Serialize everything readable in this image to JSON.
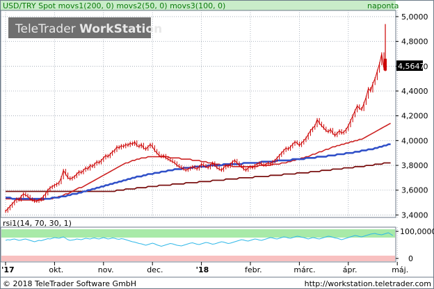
{
  "header": {
    "title": "USD/TRY Spot movs1(200, 0) movs2(50, 0) movs3(100, 0)",
    "period": "naponta"
  },
  "logo": {
    "text_regular": "TeleTrader ",
    "text_bold": "WorkStation"
  },
  "last_price": "4,5647",
  "rsi_header": "rsi1(14, 70, 30, 1)",
  "footer": {
    "copyright": "© 2018 TeleTrader Software GmbH",
    "url": "http://workstation.teletrader.com"
  },
  "colors": {
    "header_bg": "#c9ecc9",
    "header_text": "#0a7a0a",
    "price": "#cc0000",
    "ma200": "#7a1010",
    "ma50": "#cc2222",
    "ma100": "#3050c8",
    "rsi_line": "#30b8e8",
    "rsi_overbought": "#a8eaa8",
    "rsi_oversold": "#f8c0c0",
    "grid": "#9aa4b0"
  },
  "chart_data": [
    {
      "type": "line",
      "title": "USD/TRY Spot",
      "ylim": [
        3.38,
        5.05
      ],
      "y_ticks": [
        "3,4000",
        "3,6000",
        "3,8000",
        "4,0000",
        "4,2000",
        "4,4000",
        "4,6000",
        "4,8000",
        "5,0000"
      ],
      "x_ticks": [
        "'17",
        "okt.",
        "nov.",
        "dec.",
        "'18",
        "febr.",
        "márc.",
        "ápr.",
        "máj."
      ],
      "x_tick_index": [
        0,
        22,
        44,
        66,
        88,
        110,
        132,
        154,
        176
      ],
      "series": [
        {
          "name": "USD/TRY Spot",
          "values": [
            3.43,
            3.45,
            3.47,
            3.49,
            3.51,
            3.53,
            3.52,
            3.55,
            3.57,
            3.56,
            3.55,
            3.53,
            3.52,
            3.51,
            3.51,
            3.52,
            3.53,
            3.55,
            3.57,
            3.6,
            3.62,
            3.63,
            3.64,
            3.65,
            3.66,
            3.7,
            3.76,
            3.73,
            3.7,
            3.69,
            3.7,
            3.71,
            3.73,
            3.75,
            3.74,
            3.76,
            3.78,
            3.77,
            3.8,
            3.79,
            3.81,
            3.83,
            3.82,
            3.84,
            3.86,
            3.88,
            3.87,
            3.89,
            3.91,
            3.92,
            3.95,
            3.94,
            3.96,
            3.95,
            3.97,
            3.96,
            3.98,
            3.97,
            3.99,
            3.96,
            3.95,
            3.97,
            3.94,
            3.93,
            3.95,
            3.97,
            3.95,
            3.92,
            3.9,
            3.88,
            3.87,
            3.88,
            3.86,
            3.85,
            3.84,
            3.83,
            3.82,
            3.8,
            3.79,
            3.78,
            3.77,
            3.76,
            3.77,
            3.78,
            3.79,
            3.78,
            3.77,
            3.79,
            3.81,
            3.8,
            3.79,
            3.78,
            3.8,
            3.82,
            3.8,
            3.78,
            3.77,
            3.76,
            3.78,
            3.8,
            3.79,
            3.81,
            3.83,
            3.84,
            3.82,
            3.8,
            3.79,
            3.77,
            3.76,
            3.78,
            3.79,
            3.78,
            3.8,
            3.81,
            3.82,
            3.81,
            3.8,
            3.81,
            3.82,
            3.81,
            3.83,
            3.84,
            3.86,
            3.88,
            3.9,
            3.92,
            3.94,
            3.93,
            3.95,
            3.97,
            3.99,
            3.98,
            3.96,
            3.98,
            4.0,
            4.02,
            4.05,
            4.08,
            4.1,
            4.12,
            4.17,
            4.14,
            4.12,
            4.1,
            4.08,
            4.07,
            4.09,
            4.06,
            4.04,
            4.06,
            4.08,
            4.06,
            4.07,
            4.09,
            4.12,
            4.16,
            4.2,
            4.24,
            4.28,
            4.26,
            4.25,
            4.3,
            4.35,
            4.42,
            4.4,
            4.46,
            4.5,
            4.56,
            4.62,
            4.7,
            4.58
          ]
        },
        {
          "name": "movs1(200, 0)",
          "values": [
            3.59,
            3.59,
            3.59,
            3.59,
            3.59,
            3.59,
            3.59,
            3.59,
            3.59,
            3.59,
            3.59,
            3.59,
            3.59,
            3.59,
            3.59,
            3.59,
            3.59,
            3.59,
            3.59,
            3.59,
            3.59,
            3.59,
            3.59,
            3.59,
            3.59,
            3.59,
            3.59,
            3.59,
            3.59,
            3.59,
            3.59,
            3.59,
            3.59,
            3.59,
            3.59,
            3.59,
            3.59,
            3.59,
            3.59,
            3.59,
            3.59,
            3.59,
            3.59,
            3.59,
            3.59,
            3.59,
            3.59,
            3.59,
            3.59,
            3.59,
            3.6,
            3.6,
            3.6,
            3.6,
            3.61,
            3.61,
            3.61,
            3.61,
            3.61,
            3.62,
            3.62,
            3.62,
            3.62,
            3.62,
            3.63,
            3.63,
            3.63,
            3.63,
            3.63,
            3.64,
            3.64,
            3.64,
            3.64,
            3.64,
            3.64,
            3.65,
            3.65,
            3.65,
            3.65,
            3.65,
            3.65,
            3.66,
            3.66,
            3.66,
            3.66,
            3.66,
            3.66,
            3.67,
            3.67,
            3.67,
            3.67,
            3.67,
            3.67,
            3.68,
            3.68,
            3.68,
            3.68,
            3.68,
            3.68,
            3.69,
            3.69,
            3.69,
            3.69,
            3.69,
            3.69,
            3.7,
            3.7,
            3.7,
            3.7,
            3.7,
            3.7,
            3.7,
            3.71,
            3.71,
            3.71,
            3.71,
            3.71,
            3.71,
            3.71,
            3.72,
            3.72,
            3.72,
            3.72,
            3.72,
            3.72,
            3.73,
            3.73,
            3.73,
            3.73,
            3.73,
            3.73,
            3.74,
            3.74,
            3.74,
            3.74,
            3.74,
            3.74,
            3.75,
            3.75,
            3.75,
            3.75,
            3.75,
            3.76,
            3.76,
            3.76,
            3.76,
            3.76,
            3.77,
            3.77,
            3.77,
            3.77,
            3.77,
            3.78,
            3.78,
            3.78,
            3.78,
            3.78,
            3.79,
            3.79,
            3.79,
            3.79,
            3.79,
            3.8,
            3.8,
            3.8,
            3.8,
            3.81,
            3.81,
            3.81,
            3.81,
            3.82,
            3.82,
            3.82,
            3.82
          ]
        },
        {
          "name": "movs2(50, 0)",
          "values": [
            3.53,
            3.53,
            3.53,
            3.53,
            3.53,
            3.53,
            3.52,
            3.52,
            3.52,
            3.52,
            3.52,
            3.52,
            3.52,
            3.52,
            3.52,
            3.52,
            3.52,
            3.52,
            3.53,
            3.53,
            3.53,
            3.53,
            3.54,
            3.54,
            3.55,
            3.55,
            3.56,
            3.57,
            3.57,
            3.58,
            3.59,
            3.6,
            3.61,
            3.62,
            3.62,
            3.63,
            3.64,
            3.65,
            3.66,
            3.67,
            3.68,
            3.69,
            3.7,
            3.71,
            3.72,
            3.73,
            3.74,
            3.75,
            3.76,
            3.77,
            3.78,
            3.79,
            3.8,
            3.81,
            3.82,
            3.82,
            3.83,
            3.84,
            3.84,
            3.85,
            3.85,
            3.86,
            3.86,
            3.86,
            3.87,
            3.87,
            3.87,
            3.87,
            3.87,
            3.87,
            3.87,
            3.87,
            3.87,
            3.87,
            3.86,
            3.86,
            3.86,
            3.86,
            3.86,
            3.85,
            3.85,
            3.85,
            3.85,
            3.85,
            3.84,
            3.84,
            3.84,
            3.84,
            3.83,
            3.83,
            3.83,
            3.82,
            3.82,
            3.82,
            3.81,
            3.81,
            3.81,
            3.8,
            3.8,
            3.8,
            3.8,
            3.8,
            3.79,
            3.79,
            3.79,
            3.79,
            3.79,
            3.79,
            3.79,
            3.79,
            3.79,
            3.79,
            3.79,
            3.79,
            3.8,
            3.8,
            3.8,
            3.8,
            3.8,
            3.8,
            3.81,
            3.81,
            3.81,
            3.81,
            3.82,
            3.82,
            3.82,
            3.83,
            3.83,
            3.84,
            3.84,
            3.85,
            3.85,
            3.86,
            3.86,
            3.87,
            3.87,
            3.88,
            3.89,
            3.89,
            3.9,
            3.91,
            3.91,
            3.92,
            3.93,
            3.93,
            3.94,
            3.95,
            3.95,
            3.96,
            3.96,
            3.97,
            3.97,
            3.98,
            3.98,
            3.99,
            3.99,
            4.0,
            4.0,
            4.01,
            4.01,
            4.02,
            4.03,
            4.04,
            4.05,
            4.06,
            4.07,
            4.08,
            4.09,
            4.1,
            4.11,
            4.12,
            4.13,
            4.14
          ]
        },
        {
          "name": "movs3(100, 0)",
          "values": [
            3.54,
            3.54,
            3.54,
            3.53,
            3.53,
            3.53,
            3.53,
            3.53,
            3.53,
            3.53,
            3.53,
            3.53,
            3.53,
            3.53,
            3.53,
            3.53,
            3.53,
            3.53,
            3.53,
            3.53,
            3.53,
            3.54,
            3.54,
            3.54,
            3.54,
            3.55,
            3.55,
            3.55,
            3.56,
            3.56,
            3.57,
            3.57,
            3.57,
            3.58,
            3.58,
            3.59,
            3.59,
            3.6,
            3.6,
            3.61,
            3.61,
            3.62,
            3.62,
            3.63,
            3.63,
            3.64,
            3.64,
            3.65,
            3.65,
            3.66,
            3.66,
            3.67,
            3.67,
            3.68,
            3.68,
            3.69,
            3.69,
            3.7,
            3.7,
            3.71,
            3.71,
            3.71,
            3.72,
            3.72,
            3.73,
            3.73,
            3.73,
            3.74,
            3.74,
            3.74,
            3.75,
            3.75,
            3.75,
            3.76,
            3.76,
            3.76,
            3.77,
            3.77,
            3.77,
            3.77,
            3.78,
            3.78,
            3.78,
            3.78,
            3.78,
            3.79,
            3.79,
            3.79,
            3.79,
            3.79,
            3.79,
            3.8,
            3.8,
            3.8,
            3.8,
            3.8,
            3.8,
            3.8,
            3.81,
            3.81,
            3.81,
            3.81,
            3.81,
            3.81,
            3.81,
            3.81,
            3.81,
            3.82,
            3.82,
            3.82,
            3.82,
            3.82,
            3.82,
            3.82,
            3.82,
            3.83,
            3.83,
            3.83,
            3.83,
            3.83,
            3.83,
            3.83,
            3.84,
            3.84,
            3.84,
            3.84,
            3.84,
            3.84,
            3.84,
            3.85,
            3.85,
            3.85,
            3.85,
            3.85,
            3.85,
            3.86,
            3.86,
            3.86,
            3.86,
            3.86,
            3.87,
            3.87,
            3.87,
            3.87,
            3.87,
            3.88,
            3.88,
            3.88,
            3.88,
            3.89,
            3.89,
            3.89,
            3.89,
            3.9,
            3.9,
            3.9,
            3.9,
            3.91,
            3.91,
            3.91,
            3.92,
            3.92,
            3.92,
            3.93,
            3.93,
            3.93,
            3.94,
            3.94,
            3.95,
            3.95,
            3.96,
            3.96,
            3.97,
            3.97
          ]
        }
      ],
      "spike": {
        "index": 180,
        "high": 4.94,
        "low": 4.56,
        "open": 4.66,
        "close": 4.5647
      }
    },
    {
      "type": "line",
      "title": "rsi1(14, 70, 30, 1)",
      "ylim": [
        0,
        100
      ],
      "y_ticks": [
        "0",
        "100,0000"
      ],
      "bands": {
        "overbought": [
          70,
          100
        ],
        "oversold": [
          0,
          30
        ]
      },
      "series": [
        {
          "name": "rsi1(14, 70, 30, 1)",
          "values": [
            62,
            64,
            63,
            65,
            66,
            64,
            62,
            63,
            65,
            66,
            64,
            62,
            60,
            58,
            60,
            62,
            61,
            63,
            65,
            67,
            66,
            68,
            70,
            69,
            68,
            70,
            72,
            68,
            64,
            62,
            63,
            64,
            66,
            65,
            64,
            66,
            68,
            67,
            66,
            68,
            69,
            67,
            66,
            68,
            70,
            68,
            66,
            67,
            69,
            68,
            66,
            65,
            67,
            66,
            64,
            62,
            60,
            58,
            57,
            55,
            53,
            52,
            50,
            48,
            50,
            52,
            54,
            52,
            49,
            47,
            45,
            47,
            49,
            51,
            53,
            52,
            50,
            48,
            47,
            46,
            48,
            50,
            52,
            54,
            55,
            53,
            51,
            50,
            52,
            54,
            56,
            55,
            53,
            51,
            52,
            54,
            56,
            58,
            57,
            55,
            53,
            54,
            56,
            58,
            60,
            62,
            64,
            63,
            61,
            60,
            62,
            64,
            66,
            65,
            63,
            62,
            64,
            66,
            68,
            70,
            69,
            67,
            66,
            68,
            70,
            72,
            71,
            69,
            68,
            70,
            72,
            74,
            73,
            71,
            70,
            68,
            66,
            68,
            70,
            69,
            67,
            66,
            68,
            70,
            72,
            74,
            73,
            71,
            69,
            68,
            66,
            64,
            66,
            68,
            70,
            72,
            74,
            76,
            75,
            73,
            72,
            74,
            76,
            78,
            80,
            81,
            82,
            80,
            79,
            78,
            80,
            82,
            84,
            80,
            76
          ]
        }
      ]
    }
  ]
}
